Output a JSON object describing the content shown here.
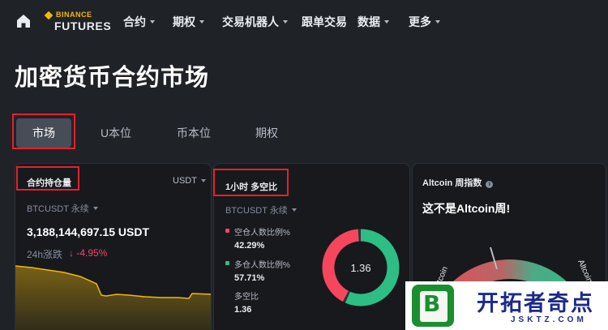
{
  "nav": {
    "logo_top": "BINANCE",
    "logo_bottom": "FUTURES",
    "items": [
      {
        "label": "合约",
        "dropdown": true
      },
      {
        "label": "期权",
        "dropdown": true
      },
      {
        "label": "交易机器人",
        "dropdown": true
      },
      {
        "label": "跟单交易",
        "dropdown": false
      },
      {
        "label": "数据",
        "dropdown": true
      },
      {
        "label": "更多",
        "dropdown": true
      }
    ]
  },
  "page_title": "加密货币合约市场",
  "tabs": [
    {
      "label": "市场",
      "active": true
    },
    {
      "label": "U本位",
      "active": false
    },
    {
      "label": "币本位",
      "active": false
    },
    {
      "label": "期权",
      "active": false
    }
  ],
  "open_interest": {
    "title": "合约持仓量",
    "unit_select": "USDT",
    "symbol": "BTCUSDT 永续",
    "value": "3,188,144,697.15 USDT",
    "change_label": "24h涨跌",
    "change_value": "↓ -4.95%"
  },
  "long_short": {
    "title": "1小时 多空比",
    "symbol": "BTCUSDT 永续",
    "short_label": "空仓人数比例%",
    "short_value": "42.29%",
    "long_label": "多仓人数比例%",
    "long_value": "57.71%",
    "ratio_label": "多空比",
    "ratio_value": "1.36",
    "ratio_center": "1.36",
    "short_pct": 42.29,
    "long_pct": 57.71
  },
  "altcoin": {
    "title": "Altcoin 周指数",
    "message": "这不是Altcoin周!",
    "left_label": "Bitcoin",
    "right_label": "Altcoin"
  },
  "watermark": {
    "icon_letter": "B",
    "text": "开拓者奇点",
    "url": "JSKTZ.COM"
  },
  "colors": {
    "short": "#f6465d",
    "long": "#2ebd85",
    "accent": "#f0b90b",
    "highlight_box": "#e5202b"
  }
}
